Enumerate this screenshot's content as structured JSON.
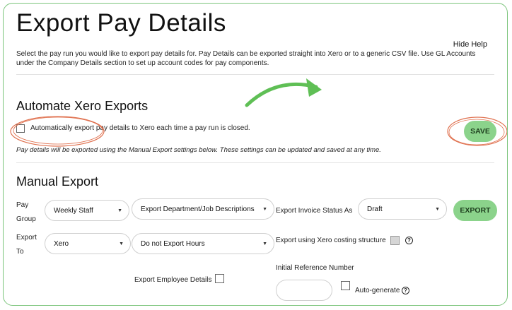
{
  "page": {
    "title": "Export Pay Details",
    "hide_help": "Hide Help",
    "intro": "Select the pay run you would like to export pay details for. Pay Details can be exported straight into Xero or to a generic CSV file. Use GL Accounts under the Company Details section to set up account codes for pay components."
  },
  "automate": {
    "heading": "Automate Xero Exports",
    "checkbox_label": "Automatically export pay details to Xero each time a pay run is closed.",
    "checked": false,
    "save_label": "SAVE",
    "note": "Pay details will be exported using the Manual Export settings below. These settings can be updated and saved at any time."
  },
  "manual": {
    "heading": "Manual Export",
    "pay_group_label_1": "Pay",
    "pay_group_label_2": "Group",
    "pay_group_value": "Weekly Staff",
    "export_dept_value": "Export Department/Job Descriptions",
    "invoice_status_label": "Export Invoice Status As",
    "invoice_status_value": "Draft",
    "export_button": "EXPORT",
    "export_to_label_1": "Export",
    "export_to_label_2": "To",
    "export_to_value": "Xero",
    "hours_value": "Do not Export Hours",
    "costing_label": "Export using Xero costing structure",
    "employee_details_label": "Export Employee Details",
    "ref_number_label": "Initial Reference Number",
    "ref_number_value": "",
    "auto_generate_label": "Auto-generate",
    "help_glyph": "?"
  },
  "colors": {
    "accent_green": "#8bd38b",
    "annotation_red": "#e0714f",
    "arrow_green": "#5fbf55"
  }
}
